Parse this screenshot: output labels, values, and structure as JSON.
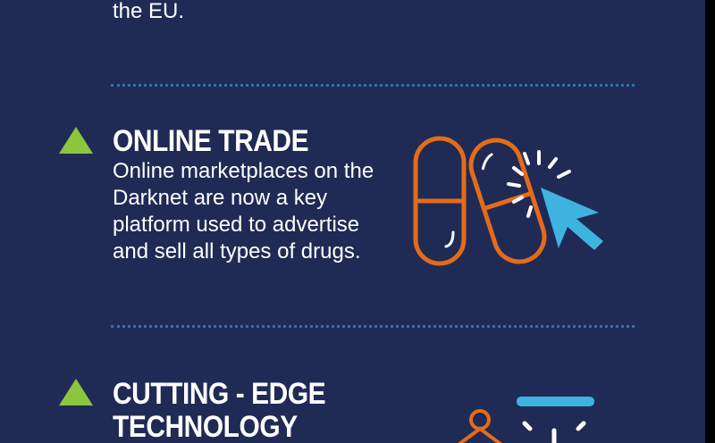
{
  "top_section": {
    "text_tail": "the EU."
  },
  "sections": [
    {
      "title": "ONLINE TRADE",
      "lines": [
        "Online marketplaces on the",
        "Darknet are now a key",
        "platform used to advertise",
        "and sell all types of drugs."
      ],
      "icon": "pill-capsules-with-cursor-icon"
    },
    {
      "title_lines": [
        "CUTTING - EDGE",
        "TECHNOLOGY"
      ],
      "icon": "technology-icon"
    }
  ],
  "colors": {
    "background": "#1f2b55",
    "accent_green": "#8cc63f",
    "accent_orange": "#e36c1a",
    "accent_blue": "#3fb3e0",
    "divider": "#3a6ea8"
  }
}
